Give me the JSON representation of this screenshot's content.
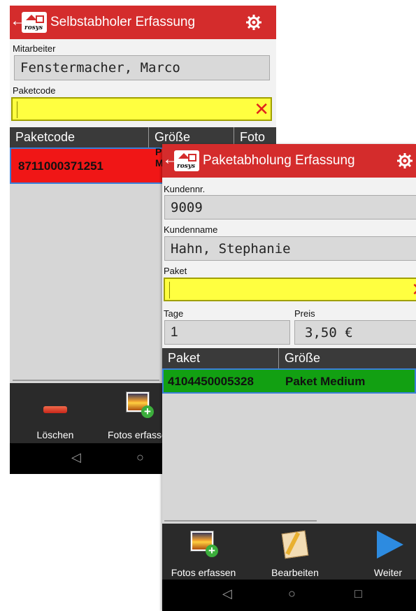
{
  "screen1": {
    "title": "Selbstabholer Erfassung",
    "back_icon": "←",
    "labels": {
      "mitarbeiter": "Mitarbeiter",
      "paketcode": "Paketcode"
    },
    "mitarbeiter_value": "Fenstermacher, Marco",
    "paketcode_value": "",
    "clear_icon": "✕",
    "table": {
      "headers": [
        "Paketcode",
        "Größe",
        "Foto"
      ],
      "rows": [
        {
          "paketcode": "8711000371251",
          "groesse": "P\nM",
          "foto": ""
        }
      ]
    },
    "actions": {
      "delete": "Löschen",
      "photos": "Fotos erfassen"
    },
    "nav": {
      "back": "◁",
      "home": "○"
    },
    "colors": {
      "appbar": "#d42c2c",
      "row": "#f01616"
    }
  },
  "screen2": {
    "title": "Paketabholung Erfassung",
    "back_icon": "←",
    "labels": {
      "kundennr": "Kundennr.",
      "kundenname": "Kundenname",
      "paket": "Paket",
      "tage": "Tage",
      "preis": "Preis"
    },
    "kundennr_value": "9009",
    "kundenname_value": "Hahn, Stephanie",
    "paket_value": "",
    "tage_value": "1",
    "preis_value": "3,50 €",
    "clear_icon": "✕",
    "table": {
      "headers": [
        "Paket",
        "Größe"
      ],
      "rows": [
        {
          "paket": "4104450005328",
          "groesse": "Paket Medium"
        }
      ]
    },
    "actions": {
      "photos": "Fotos erfassen",
      "edit": "Bearbeiten",
      "next": "Weiter"
    },
    "nav": {
      "back": "◁",
      "home": "○",
      "recent": "□"
    },
    "colors": {
      "appbar": "#d42c2c",
      "row": "#12a012"
    }
  }
}
